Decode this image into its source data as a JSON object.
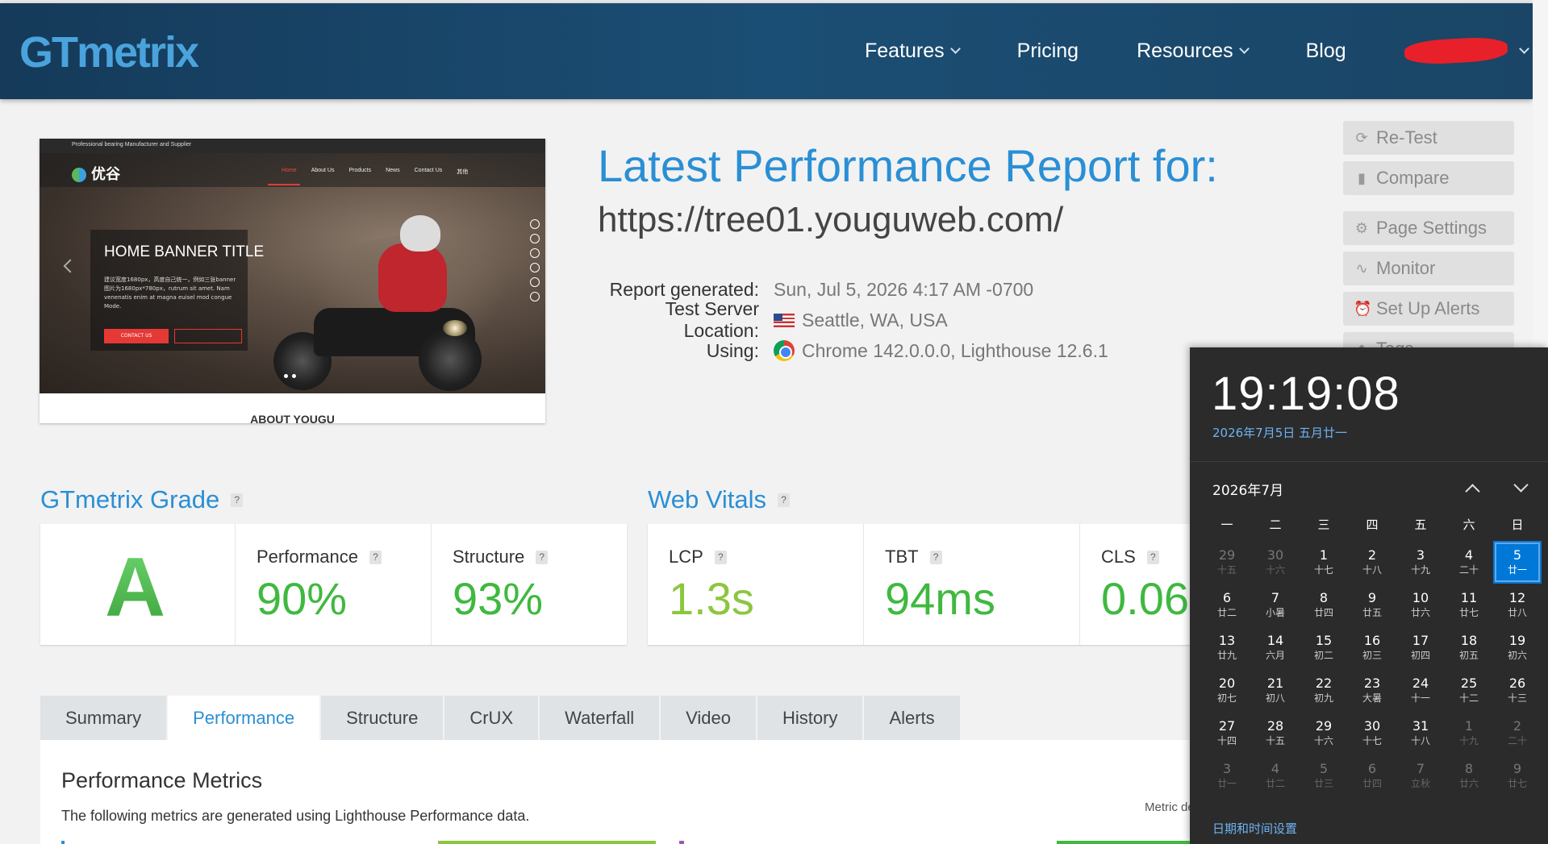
{
  "header": {
    "logo": "GTmetrix",
    "nav": [
      "Features",
      "Pricing",
      "Resources",
      "Blog"
    ]
  },
  "thumbnail": {
    "topbar": "Professional bearing Manufacturer and Supplier",
    "site_logo": "优谷",
    "menu": [
      "Home",
      "About Us",
      "Products",
      "News",
      "Contact Us",
      "其他"
    ],
    "banner_title": "HOME BANNER TITLE",
    "banner_text": "建议宽度1680px，高度自己统一，例如三张banner图片为1680px*780px，rutrum sit amet. Nam venenatis enim at magna euisel mod congue Mode.",
    "banner_button": "CONTACT US",
    "about": "ABOUT YOUGU"
  },
  "report": {
    "title": "Latest Performance Report for:",
    "url": "https://tree01.youguweb.com/",
    "generated_label": "Report generated:",
    "generated_value": "Sun, Jul 5, 2026 4:17 AM -0700",
    "location_label": "Test Server Location:",
    "location_value": "Seattle, WA, USA",
    "using_label": "Using:",
    "using_value": "Chrome 142.0.0.0, Lighthouse 12.6.1"
  },
  "sidebar": {
    "retest": "Re-Test",
    "compare": "Compare",
    "page_settings": "Page Settings",
    "monitor": "Monitor",
    "alerts": "Set Up Alerts",
    "tags": "Tags"
  },
  "grade": {
    "title": "GTmetrix Grade",
    "letter": "A",
    "performance_label": "Performance",
    "performance_value": "90%",
    "structure_label": "Structure",
    "structure_value": "93%"
  },
  "vitals": {
    "title": "Web Vitals",
    "lcp_label": "LCP",
    "lcp_value": "1.3s",
    "tbt_label": "TBT",
    "tbt_value": "94ms",
    "cls_label": "CLS",
    "cls_value": "0.06"
  },
  "tabs": [
    "Summary",
    "Performance",
    "Structure",
    "CrUX",
    "Waterfall",
    "Video",
    "History",
    "Alerts"
  ],
  "active_tab": "Performance",
  "panel": {
    "title": "Performance Metrics",
    "description": "The following metrics are generated using Lighthouse Performance data.",
    "metric_def": "Metric de"
  },
  "clock": {
    "time": "19:19:08",
    "date": "2026年7月5日 五月廿一",
    "month": "2026年7月",
    "weekdays": [
      "一",
      "二",
      "三",
      "四",
      "五",
      "六",
      "日"
    ],
    "weeks": [
      [
        [
          "29",
          "十五",
          1
        ],
        [
          "30",
          "十六",
          1
        ],
        [
          "1",
          "十七",
          0
        ],
        [
          "2",
          "十八",
          0
        ],
        [
          "3",
          "十九",
          0
        ],
        [
          "4",
          "二十",
          0
        ],
        [
          "5",
          "廿一",
          2
        ]
      ],
      [
        [
          "6",
          "廿二",
          0
        ],
        [
          "7",
          "小暑",
          0
        ],
        [
          "8",
          "廿四",
          0
        ],
        [
          "9",
          "廿五",
          0
        ],
        [
          "10",
          "廿六",
          0
        ],
        [
          "11",
          "廿七",
          0
        ],
        [
          "12",
          "廿八",
          0
        ]
      ],
      [
        [
          "13",
          "廿九",
          0
        ],
        [
          "14",
          "六月",
          0
        ],
        [
          "15",
          "初二",
          0
        ],
        [
          "16",
          "初三",
          0
        ],
        [
          "17",
          "初四",
          0
        ],
        [
          "18",
          "初五",
          0
        ],
        [
          "19",
          "初六",
          0
        ]
      ],
      [
        [
          "20",
          "初七",
          0
        ],
        [
          "21",
          "初八",
          0
        ],
        [
          "22",
          "初九",
          0
        ],
        [
          "23",
          "大暑",
          0
        ],
        [
          "24",
          "十一",
          0
        ],
        [
          "25",
          "十二",
          0
        ],
        [
          "26",
          "十三",
          0
        ]
      ],
      [
        [
          "27",
          "十四",
          0
        ],
        [
          "28",
          "十五",
          0
        ],
        [
          "29",
          "十六",
          0
        ],
        [
          "30",
          "十七",
          0
        ],
        [
          "31",
          "十八",
          0
        ],
        [
          "1",
          "十九",
          1
        ],
        [
          "2",
          "二十",
          1
        ]
      ],
      [
        [
          "3",
          "廿一",
          1
        ],
        [
          "4",
          "廿二",
          1
        ],
        [
          "5",
          "廿三",
          1
        ],
        [
          "6",
          "廿四",
          1
        ],
        [
          "7",
          "立秋",
          1
        ],
        [
          "8",
          "廿六",
          1
        ],
        [
          "9",
          "廿七",
          1
        ]
      ]
    ],
    "settings": "日期和时间设置"
  },
  "colors": {
    "header": "#1b4e74",
    "accent": "#2a8fd5",
    "grade_green": "#3fb93f",
    "today": "#0078d7"
  }
}
